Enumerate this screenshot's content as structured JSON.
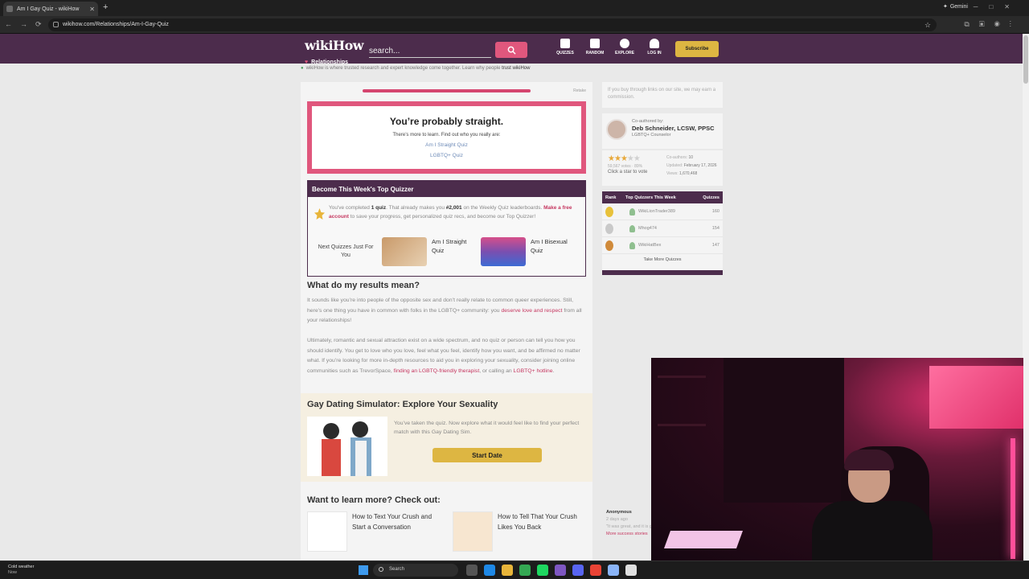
{
  "browser": {
    "tab_title": "Am I Gay Quiz - wikiHow",
    "gemini_label": "Gemini",
    "url": "wikihow.com/Relationships/Am-I-Gay-Quiz"
  },
  "header": {
    "logo": "wikiHow",
    "logo_sub": "Relationships",
    "search_placeholder": "search...",
    "nav": [
      {
        "label": "QUIZZES"
      },
      {
        "label": "RANDOM"
      },
      {
        "label": "EXPLORE"
      },
      {
        "label": "LOG IN"
      }
    ],
    "subscribe": "Subscribe",
    "trust_text": "wikiHow is where trusted research and expert knowledge come together. Learn why people",
    "trust_link": "trust wikiHow"
  },
  "quiz": {
    "progress_fraction": 1.0,
    "retake": "Retake",
    "result_title": "You’re probably straight.",
    "result_sub": "There’s more to learn. Find out who you really are:",
    "links": [
      "Am I Straight Quiz",
      "LGBTQ+ Quiz"
    ]
  },
  "quizzer": {
    "header": "Become This Week's Top Quizzer",
    "t1": "You've completed ",
    "quiz_count": "1 quiz",
    "t2": ". That already makes you ",
    "rank": "#2,001",
    "t3": " on the Weekly Quiz leaderboards. ",
    "account_link": "Make a free account",
    "t4": " to save your progress, get personalized quiz recs, and become our Top Quizzer!",
    "next_label": "Next Quizzes Just For You",
    "next_quizzes": [
      {
        "label": "Am I Straight Quiz"
      },
      {
        "label": "Am I Bisexual Quiz"
      }
    ]
  },
  "article": {
    "h_means": "What do my results mean?",
    "p1a": "It sounds like you’re into people of the opposite sex and don’t really relate to common queer experiences. Still, here’s one thing you have in common with folks in the LGBTQ+ community: you ",
    "p1_link": "deserve love and respect",
    "p1b": " from all your relationships!",
    "p2a": "Ultimately, romantic and sexual attraction exist on a wide spectrum, and no quiz or person can tell you how you should identify. You get to love who you love, feel what you feel, identify how you want, and be affirmed no matter what. If you’re looking for more in-depth resources to aid you in exploring your sexuality, consider joining online communities such as TrevorSpace, ",
    "p2_link1": "finding an LGBTQ-friendly therapist",
    "p2b": ", or calling an ",
    "p2_link2": "LGBTQ+ hotline",
    "p2c": ".",
    "sim_title": "Gay Dating Simulator: Explore Your Sexuality",
    "sim_text": "You’ve taken the quiz. Now explore what it would feel like to find your perfect match with this Gay Dating Sim.",
    "sim_button": "Start Date",
    "learn_title": "Want to learn more? Check out:",
    "learn_cards": [
      {
        "label": "How to Text Your Crush and Start a Conversation"
      },
      {
        "label": "How to Tell That Your Crush Likes You Back"
      }
    ]
  },
  "sidebar": {
    "note": "If you buy through links on our site, we may earn a commission.",
    "coauthored": "Co-authored by:",
    "author_name": "Deb Schneider, LCSW, PPSC",
    "author_title": "LGBTQ+ Counselor",
    "rating": 3,
    "rating_max": 5,
    "votes": "59,567 votes · 89%",
    "vote_cta": "Click a star to vote",
    "stats": [
      {
        "k": "Co-authors: ",
        "v": "10"
      },
      {
        "k": "Updated: ",
        "v": "February 17, 2026"
      },
      {
        "k": "Views: ",
        "v": "1,670,468"
      }
    ],
    "leader_head": {
      "rank": "Rank",
      "title": "Top Quizzers This Week",
      "col": "Quizzes"
    },
    "leaders": [
      {
        "name": "WikiLionTrader389",
        "pts": "160",
        "medal": "#e8c13a"
      },
      {
        "name": "Mhog474",
        "pts": "154",
        "medal": "#c9c9c9"
      },
      {
        "name": "WikiHatBex",
        "pts": "147",
        "medal": "#d08a3a"
      }
    ],
    "take_more": "Take More Quizzes",
    "review_name": "Anonymous",
    "review_date": "2 days ago",
    "review_text": "\"It was great, and it is good to \"",
    "review_more": "More success stories"
  },
  "taskbar": {
    "weather": "Cold weather",
    "weather_time": "Now",
    "search": "Search",
    "apps": [
      "#555",
      "#1e88e5",
      "#e8b53a",
      "#34a853",
      "#1ed760",
      "#7e57c2",
      "#5865f2",
      "#ea4335",
      "#8ab4f8",
      "#e0e0e0"
    ]
  }
}
